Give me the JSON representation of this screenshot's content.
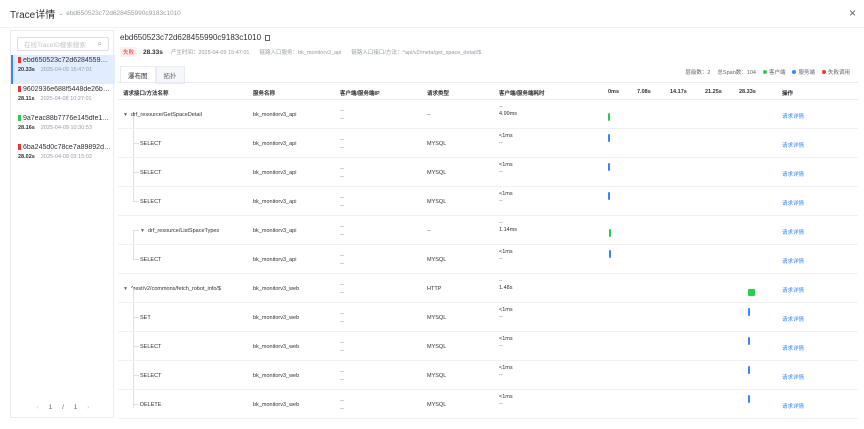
{
  "header": {
    "title": "Trace详情",
    "sep": "-",
    "trace_id": "ebd650523c72d628455990c9183c1010"
  },
  "left": {
    "search_placeholder": "在线TraceID搜索搜索",
    "items": [
      {
        "id": "ebd650523c72d628455990c...",
        "duration": "20.33s",
        "time": "2025-04-09 15:47:01",
        "status": "fail",
        "active": true
      },
      {
        "id": "9602936e688f5448de26b23...",
        "duration": "28.11s",
        "time": "2025-04-08 10:27:01",
        "status": "fail",
        "active": false
      },
      {
        "id": "9a7eac88b7776e145dfe1198...",
        "duration": "28.16s",
        "time": "2025-04-09 10:30:53",
        "status": "ok",
        "active": false
      },
      {
        "id": "6ba245d0c78ce7a89892d63...",
        "duration": "28.02s",
        "time": "2025-04-09 03:15:02",
        "status": "fail",
        "active": false
      }
    ],
    "pager": {
      "prev": "‹",
      "current": "1",
      "sep": "/",
      "total": "1",
      "next": "›"
    }
  },
  "detail": {
    "trace_id": "ebd650523c72d628455990c9183c1010",
    "status_badge": "失败",
    "duration": "28.33s",
    "produce_time": "产生时间：2025-04-09 15:47:01",
    "entry_service": "链路入口服务：bk_monitorv3_api",
    "entry_api": "链路入口接口/方法：^api/v2/meta/get_space_detail/$",
    "tabs": [
      "瀑布图",
      "拓扑"
    ],
    "stats": {
      "depth": "层级数：2",
      "span_count": "总Span数：104",
      "client": "客户端",
      "server": "服务端",
      "failed": "失败调用"
    },
    "colors": {
      "client": "#2dcb56",
      "server": "#3a84ff",
      "failed": "#ea3636"
    }
  },
  "table": {
    "headers": {
      "name": "请求接口/方法名称",
      "service": "服务名称",
      "ip": "客户端/服务端IP",
      "type": "请求类型",
      "duration": "客户端/服务端耗时",
      "t0": "0ms",
      "t1": "7.08s",
      "t2": "14.17s",
      "t3": "21.25s",
      "t4": "28.33s",
      "op": "操作"
    },
    "rows": [
      {
        "name": "drf_resource/GetSpaceDetail",
        "service": "bk_monitorv3_api",
        "ip1": "--",
        "ip2": "--",
        "type": "--",
        "d1": "--",
        "d2": "4.99ms",
        "op": "请求详情"
      },
      {
        "name": "SELECT",
        "service": "bk_monitorv3_api",
        "ip1": "--",
        "ip2": "--",
        "type": "MYSQL",
        "d1": "<1ms",
        "d2": "--",
        "op": "请求详情"
      },
      {
        "name": "SELECT",
        "service": "bk_monitorv3_api",
        "ip1": "--",
        "ip2": "--",
        "type": "MYSQL",
        "d1": "<1ms",
        "d2": "--",
        "op": "请求详情"
      },
      {
        "name": "SELECT",
        "service": "bk_monitorv3_api",
        "ip1": "--",
        "ip2": "--",
        "type": "MYSQL",
        "d1": "<1ms",
        "d2": "--",
        "op": "请求详情"
      },
      {
        "name": "drf_resource/ListSpaceTypes",
        "service": "bk_monitorv3_api",
        "ip1": "--",
        "ip2": "--",
        "type": "--",
        "d1": "--",
        "d2": "1.14ms",
        "op": "请求详情"
      },
      {
        "name": "SELECT",
        "service": "bk_monitorv3_api",
        "ip1": "--",
        "ip2": "--",
        "type": "MYSQL",
        "d1": "<1ms",
        "d2": "--",
        "op": "请求详情"
      },
      {
        "name": "^rest/v2/commons/fetch_robot_info/$",
        "service": "bk_monitorv3_web",
        "ip1": "--",
        "ip2": "--",
        "type": "HTTP",
        "d1": "--",
        "d2": "1.48s",
        "op": "请求详情"
      },
      {
        "name": "SET",
        "service": "bk_monitorv3_web",
        "ip1": "--",
        "ip2": "--",
        "type": "MYSQL",
        "d1": "<1ms",
        "d2": "--",
        "op": "请求详情"
      },
      {
        "name": "SELECT",
        "service": "bk_monitorv3_web",
        "ip1": "--",
        "ip2": "--",
        "type": "MYSQL",
        "d1": "<1ms",
        "d2": "--",
        "op": "请求详情"
      },
      {
        "name": "SELECT",
        "service": "bk_monitorv3_web",
        "ip1": "--",
        "ip2": "--",
        "type": "MYSQL",
        "d1": "<1ms",
        "d2": "--",
        "op": "请求详情"
      },
      {
        "name": "DELETE",
        "service": "bk_monitorv3_web",
        "ip1": "--",
        "ip2": "--",
        "type": "MYSQL",
        "d1": "<1ms",
        "d2": "--",
        "op": "请求详情"
      }
    ]
  }
}
